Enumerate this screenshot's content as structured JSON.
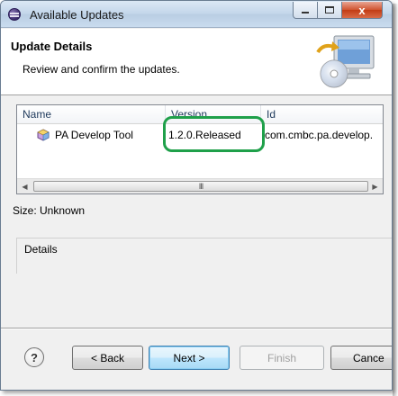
{
  "window": {
    "title": "Available Updates",
    "controls": {
      "minimize_icon": "minimize-icon",
      "maximize_icon": "maximize-icon",
      "close_label": "x"
    }
  },
  "banner": {
    "title": "Update Details",
    "description": "Review and confirm the updates.",
    "graphic_icon": "computer-cd-update-icon"
  },
  "table": {
    "columns": [
      "Name",
      "Version",
      "Id"
    ],
    "rows": [
      {
        "icon": "feature-plugin-icon",
        "name": "PA Develop Tool",
        "version": "1.2.0.Released",
        "id": "com.cmbc.pa.develop."
      }
    ],
    "scroll_thumb_grip": "III"
  },
  "size_label": "Size: Unknown",
  "details_label": "Details",
  "annotation": {
    "highlight_color": "#1fa04a"
  },
  "buttons": {
    "help": "?",
    "back": "< Back",
    "next": "Next >",
    "finish": "Finish",
    "cancel": "Cance"
  },
  "colors": {
    "accent": "#3c7fb1",
    "disabled_text": "#a0a0a0"
  }
}
